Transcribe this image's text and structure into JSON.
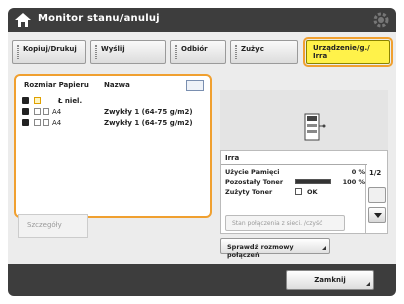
{
  "header": {
    "title": "Monitor stanu/anuluj"
  },
  "tabs": [
    {
      "label": "Kopiuj/Drukuj"
    },
    {
      "label": "Wyślij"
    },
    {
      "label": "Odbiór"
    },
    {
      "label": "Zużyc"
    },
    {
      "label": "Urządzenie/g./ Irra"
    }
  ],
  "paper": {
    "headers": {
      "col1": "Rozmiar Papieru",
      "col2": "Nazwa"
    },
    "rows": [
      {
        "num": "",
        "size": "Ł niel.",
        "type": ""
      },
      {
        "num": "",
        "size": "A4",
        "type": "Zwykły 1 (64-75 g/m2)"
      },
      {
        "num": "",
        "size": "A4",
        "type": "Zwykły 1 (64-75 g/m2)"
      }
    ]
  },
  "under_button": {
    "label": "Szczegóły"
  },
  "status_panel": {
    "name": "Irra",
    "rows": [
      {
        "label": "Użycie Pamięci",
        "value": "0 %"
      },
      {
        "label": "Pozostały Toner",
        "value": "100 %",
        "level": 1.0
      },
      {
        "label": "Zużyty Toner",
        "value": "OK"
      }
    ],
    "page": "1/2",
    "stop_button": "Stan połączenia z sieci. /czyść"
  },
  "status_button": {
    "label": "Sprawdź rozmowy połączeń"
  },
  "footer": {
    "close_label": "Zamknij"
  },
  "colors": {
    "accent": "#f0a030",
    "active_tab": "#fff24a",
    "bar_bg": "#3d3d3d"
  }
}
